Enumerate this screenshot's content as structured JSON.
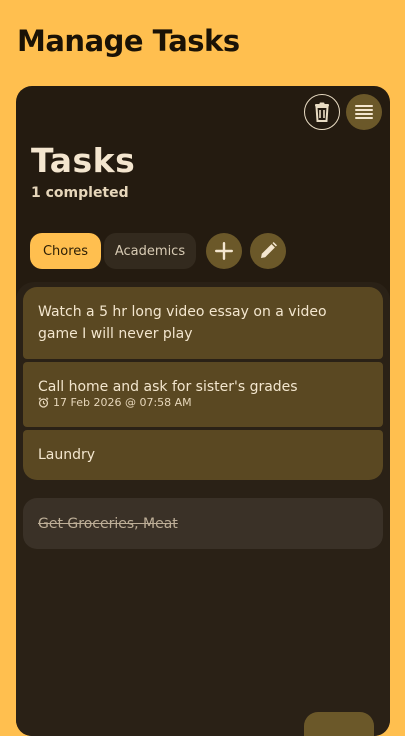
{
  "header": {
    "title": "Manage Tasks"
  },
  "panel": {
    "title": "Tasks",
    "completed_text": "1 completed",
    "toolbar": {
      "delete_icon": "trash-icon",
      "menu_icon": "menu-icon"
    }
  },
  "tabs": [
    {
      "label": "Chores",
      "selected": true
    },
    {
      "label": "Academics",
      "selected": false
    }
  ],
  "actions": {
    "add_icon": "plus-icon",
    "edit_icon": "pencil-icon"
  },
  "tasks": [
    {
      "title": "Watch a 5 hr long video essay on a video game I will never play"
    },
    {
      "title": "Call home and ask for sister's grades",
      "reminder": "17 Feb 2026 @ 07:58 AM",
      "reminder_icon": "alarm-icon"
    },
    {
      "title": "Laundry"
    }
  ],
  "completed_tasks": [
    {
      "title": "Get Groceries, Meat"
    }
  ],
  "colors": {
    "background": "#FFBF4F",
    "panel": "#241B10",
    "card": "#5A4822",
    "accent": "#FFBF4F"
  }
}
